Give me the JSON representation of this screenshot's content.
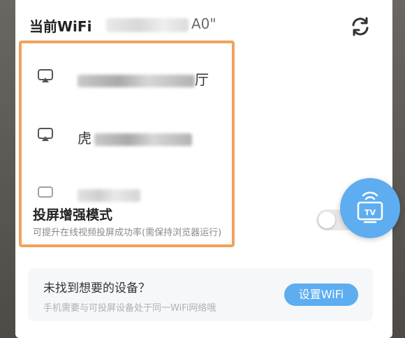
{
  "header": {
    "title": "当前WiFi",
    "ssid_suffix": "A0\"",
    "refresh_icon": "refresh-icon"
  },
  "devices": [
    {
      "icon": "screen-cast-icon",
      "name_suffix": "厅"
    },
    {
      "icon": "screen-cast-icon",
      "name_prefix": "虎"
    },
    {
      "icon": "screen-cast-icon"
    }
  ],
  "boost_mode": {
    "title": "投屏增强模式",
    "description": "可提升在线视频投屏成功率(需保持浏览器运行)",
    "enabled": false
  },
  "fab": {
    "icon": "tv-icon",
    "label": "TV"
  },
  "help": {
    "title": "未找到想要的设备？",
    "description": "手机需要与可投屏设备处于同一WiFi网络哦",
    "button_label": "设置WiFi"
  },
  "colors": {
    "accent": "#5dadf0",
    "highlight_border": "#f0a25a"
  }
}
